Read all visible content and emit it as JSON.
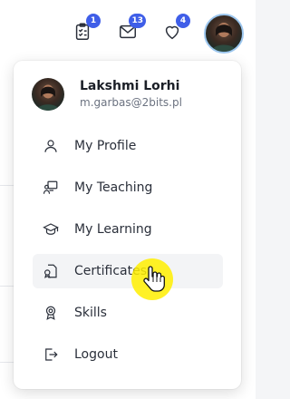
{
  "header": {
    "tasks_badge": "1",
    "mail_badge": "13",
    "favorites_badge": "4"
  },
  "user": {
    "name": "Lakshmi Lorhi",
    "email": "m.garbas@2bits.pl"
  },
  "menu": {
    "items": [
      {
        "label": "My Profile",
        "icon": "user-icon"
      },
      {
        "label": "My Teaching",
        "icon": "teaching-icon"
      },
      {
        "label": "My Learning",
        "icon": "graduation-cap-icon"
      },
      {
        "label": "Certificates",
        "icon": "certificate-icon",
        "active": true
      },
      {
        "label": "Skills",
        "icon": "award-icon"
      },
      {
        "label": "Logout",
        "icon": "logout-icon"
      }
    ]
  },
  "colors": {
    "badge": "#3f5ee8",
    "avatar_ring": "#9cc6ee",
    "active_item_bg": "#f3f4f6",
    "cursor_halo": "#ffee00"
  }
}
